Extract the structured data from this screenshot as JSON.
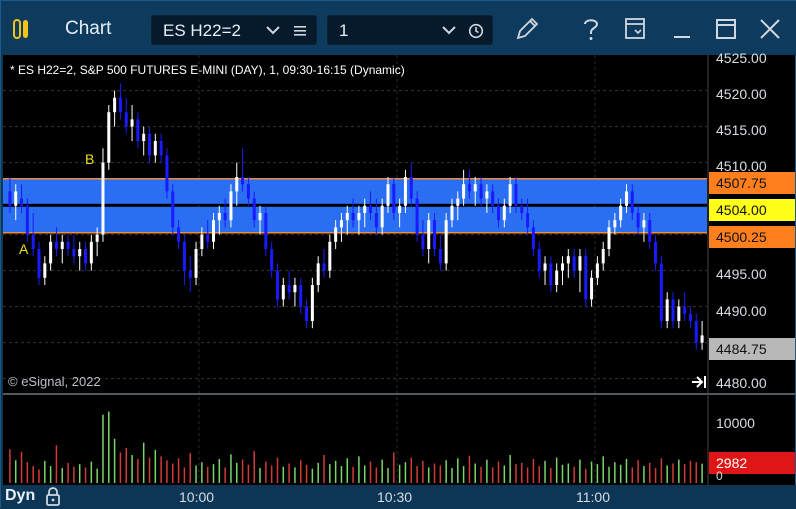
{
  "window": {
    "title": "Chart"
  },
  "toolbar": {
    "symbol": "ES H22=2",
    "interval": "1"
  },
  "chart": {
    "header": "* ES H22=2, S&P 500 FUTURES E-MINI (DAY), 1, 09:30-16:15 (Dynamic)",
    "copyright": "© eSignal, 2022",
    "price_ticks": [
      "4525.00",
      "4520.00",
      "4515.00",
      "4510.00",
      "4495.00",
      "4490.00",
      "4480.00"
    ],
    "price_tags": {
      "upper": "4507.75",
      "mid": "4504.00",
      "lower": "4500.25",
      "last": "4484.75"
    },
    "markers": {
      "a": "A",
      "b": "B"
    },
    "volume": {
      "tick": "10000",
      "tag": "2982",
      "zero": "0"
    },
    "time_ticks": [
      "10:00",
      "10:30",
      "11:00"
    ],
    "footer": {
      "mode": "Dyn"
    },
    "colors": {
      "up_candle": "#ffffff",
      "down_candle": "#1a1aff",
      "band": "#2a6ff2",
      "band_edge": "#f08c3c",
      "vol_up": "#7ad66a",
      "vol_down": "#d23a3a"
    }
  },
  "chart_data": {
    "type": "candlestick",
    "title": "* ES H22=2, S&P 500 FUTURES E-MINI (DAY), 1, 09:30-16:15 (Dynamic)",
    "x_axis": [
      "10:00",
      "10:30",
      "11:00"
    ],
    "ylim": [
      4478,
      4526
    ],
    "levels": {
      "band_upper": 4507.75,
      "band_mid": 4504.0,
      "band_lower": 4500.25,
      "last": 4484.75
    },
    "candles": [
      {
        "o": 4506,
        "h": 4508,
        "l": 4503,
        "c": 4504
      },
      {
        "o": 4504,
        "h": 4507,
        "l": 4502,
        "c": 4506
      },
      {
        "o": 4505,
        "h": 4507,
        "l": 4503,
        "c": 4504
      },
      {
        "o": 4504,
        "h": 4505,
        "l": 4499,
        "c": 4500
      },
      {
        "o": 4500,
        "h": 4503,
        "l": 4497,
        "c": 4498
      },
      {
        "o": 4498,
        "h": 4499,
        "l": 4493,
        "c": 4494
      },
      {
        "o": 4494,
        "h": 4497,
        "l": 4493,
        "c": 4496
      },
      {
        "o": 4496,
        "h": 4500,
        "l": 4495,
        "c": 4499
      },
      {
        "o": 4499,
        "h": 4501,
        "l": 4497,
        "c": 4498
      },
      {
        "o": 4498,
        "h": 4500,
        "l": 4496,
        "c": 4499
      },
      {
        "o": 4499,
        "h": 4500,
        "l": 4497,
        "c": 4498
      },
      {
        "o": 4498,
        "h": 4500,
        "l": 4496,
        "c": 4497
      },
      {
        "o": 4497,
        "h": 4499,
        "l": 4495,
        "c": 4498
      },
      {
        "o": 4498,
        "h": 4499,
        "l": 4495,
        "c": 4496
      },
      {
        "o": 4496,
        "h": 4500,
        "l": 4495,
        "c": 4499
      },
      {
        "o": 4499,
        "h": 4501,
        "l": 4497,
        "c": 4500
      },
      {
        "o": 4500,
        "h": 4512,
        "l": 4499,
        "c": 4510
      },
      {
        "o": 4510,
        "h": 4518,
        "l": 4509,
        "c": 4517
      },
      {
        "o": 4517,
        "h": 4520,
        "l": 4515,
        "c": 4519
      },
      {
        "o": 4519,
        "h": 4521,
        "l": 4516,
        "c": 4517
      },
      {
        "o": 4517,
        "h": 4519,
        "l": 4514,
        "c": 4515
      },
      {
        "o": 4515,
        "h": 4518,
        "l": 4513,
        "c": 4516
      },
      {
        "o": 4516,
        "h": 4517,
        "l": 4512,
        "c": 4513
      },
      {
        "o": 4513,
        "h": 4515,
        "l": 4511,
        "c": 4514
      },
      {
        "o": 4514,
        "h": 4515,
        "l": 4510,
        "c": 4511
      },
      {
        "o": 4511,
        "h": 4514,
        "l": 4510,
        "c": 4513
      },
      {
        "o": 4513,
        "h": 4514,
        "l": 4510,
        "c": 4511
      },
      {
        "o": 4511,
        "h": 4512,
        "l": 4505,
        "c": 4506
      },
      {
        "o": 4506,
        "h": 4507,
        "l": 4500,
        "c": 4501
      },
      {
        "o": 4501,
        "h": 4502,
        "l": 4498,
        "c": 4499
      },
      {
        "o": 4499,
        "h": 4500,
        "l": 4493,
        "c": 4495
      },
      {
        "o": 4495,
        "h": 4497,
        "l": 4492,
        "c": 4494
      },
      {
        "o": 4494,
        "h": 4499,
        "l": 4493,
        "c": 4498
      },
      {
        "o": 4498,
        "h": 4501,
        "l": 4497,
        "c": 4500
      },
      {
        "o": 4500,
        "h": 4502,
        "l": 4498,
        "c": 4499
      },
      {
        "o": 4499,
        "h": 4503,
        "l": 4498,
        "c": 4502
      },
      {
        "o": 4502,
        "h": 4504,
        "l": 4500,
        "c": 4503
      },
      {
        "o": 4503,
        "h": 4505,
        "l": 4501,
        "c": 4502
      },
      {
        "o": 4502,
        "h": 4507,
        "l": 4501,
        "c": 4506
      },
      {
        "o": 4506,
        "h": 4510,
        "l": 4504,
        "c": 4508
      },
      {
        "o": 4508,
        "h": 4512,
        "l": 4506,
        "c": 4507
      },
      {
        "o": 4507,
        "h": 4508,
        "l": 4504,
        "c": 4505
      },
      {
        "o": 4505,
        "h": 4506,
        "l": 4501,
        "c": 4502
      },
      {
        "o": 4502,
        "h": 4504,
        "l": 4500,
        "c": 4503
      },
      {
        "o": 4503,
        "h": 4504,
        "l": 4497,
        "c": 4498
      },
      {
        "o": 4498,
        "h": 4499,
        "l": 4494,
        "c": 4495
      },
      {
        "o": 4495,
        "h": 4496,
        "l": 4490,
        "c": 4491
      },
      {
        "o": 4491,
        "h": 4494,
        "l": 4490,
        "c": 4493
      },
      {
        "o": 4493,
        "h": 4495,
        "l": 4491,
        "c": 4492
      },
      {
        "o": 4492,
        "h": 4494,
        "l": 4490,
        "c": 4493
      },
      {
        "o": 4493,
        "h": 4494,
        "l": 4489,
        "c": 4490
      },
      {
        "o": 4490,
        "h": 4491,
        "l": 4487,
        "c": 4488
      },
      {
        "o": 4488,
        "h": 4494,
        "l": 4487,
        "c": 4493
      },
      {
        "o": 4493,
        "h": 4497,
        "l": 4492,
        "c": 4496
      },
      {
        "o": 4496,
        "h": 4498,
        "l": 4494,
        "c": 4495
      },
      {
        "o": 4495,
        "h": 4500,
        "l": 4494,
        "c": 4499
      },
      {
        "o": 4499,
        "h": 4502,
        "l": 4498,
        "c": 4501
      },
      {
        "o": 4501,
        "h": 4503,
        "l": 4499,
        "c": 4502
      },
      {
        "o": 4502,
        "h": 4504,
        "l": 4500,
        "c": 4503
      },
      {
        "o": 4503,
        "h": 4505,
        "l": 4501,
        "c": 4502
      },
      {
        "o": 4502,
        "h": 4504,
        "l": 4500,
        "c": 4503
      },
      {
        "o": 4503,
        "h": 4505,
        "l": 4501,
        "c": 4504
      },
      {
        "o": 4504,
        "h": 4506,
        "l": 4502,
        "c": 4503
      },
      {
        "o": 4503,
        "h": 4505,
        "l": 4500,
        "c": 4501
      },
      {
        "o": 4501,
        "h": 4505,
        "l": 4500,
        "c": 4504
      },
      {
        "o": 4504,
        "h": 4508,
        "l": 4503,
        "c": 4507
      },
      {
        "o": 4507,
        "h": 4508,
        "l": 4502,
        "c": 4503
      },
      {
        "o": 4503,
        "h": 4505,
        "l": 4501,
        "c": 4504
      },
      {
        "o": 4504,
        "h": 4509,
        "l": 4503,
        "c": 4508
      },
      {
        "o": 4508,
        "h": 4510,
        "l": 4504,
        "c": 4505
      },
      {
        "o": 4505,
        "h": 4506,
        "l": 4499,
        "c": 4500
      },
      {
        "o": 4500,
        "h": 4502,
        "l": 4497,
        "c": 4498
      },
      {
        "o": 4498,
        "h": 4503,
        "l": 4496,
        "c": 4502
      },
      {
        "o": 4502,
        "h": 4503,
        "l": 4497,
        "c": 4498
      },
      {
        "o": 4498,
        "h": 4500,
        "l": 4495,
        "c": 4496
      },
      {
        "o": 4496,
        "h": 4503,
        "l": 4495,
        "c": 4502
      },
      {
        "o": 4502,
        "h": 4505,
        "l": 4501,
        "c": 4504
      },
      {
        "o": 4504,
        "h": 4506,
        "l": 4502,
        "c": 4505
      },
      {
        "o": 4505,
        "h": 4509,
        "l": 4504,
        "c": 4507
      },
      {
        "o": 4507,
        "h": 4509,
        "l": 4505,
        "c": 4506
      },
      {
        "o": 4506,
        "h": 4508,
        "l": 4504,
        "c": 4507
      },
      {
        "o": 4507,
        "h": 4508,
        "l": 4504,
        "c": 4505
      },
      {
        "o": 4505,
        "h": 4507,
        "l": 4503,
        "c": 4506
      },
      {
        "o": 4506,
        "h": 4507,
        "l": 4503,
        "c": 4504
      },
      {
        "o": 4504,
        "h": 4505,
        "l": 4501,
        "c": 4502
      },
      {
        "o": 4502,
        "h": 4505,
        "l": 4501,
        "c": 4504
      },
      {
        "o": 4504,
        "h": 4508,
        "l": 4503,
        "c": 4507
      },
      {
        "o": 4507,
        "h": 4508,
        "l": 4503,
        "c": 4504
      },
      {
        "o": 4504,
        "h": 4505,
        "l": 4502,
        "c": 4503
      },
      {
        "o": 4503,
        "h": 4505,
        "l": 4500,
        "c": 4501
      },
      {
        "o": 4501,
        "h": 4502,
        "l": 4497,
        "c": 4498
      },
      {
        "o": 4498,
        "h": 4499,
        "l": 4494,
        "c": 4495
      },
      {
        "o": 4495,
        "h": 4497,
        "l": 4493,
        "c": 4496
      },
      {
        "o": 4496,
        "h": 4497,
        "l": 4492,
        "c": 4493
      },
      {
        "o": 4493,
        "h": 4496,
        "l": 4492,
        "c": 4495
      },
      {
        "o": 4495,
        "h": 4497,
        "l": 4493,
        "c": 4496
      },
      {
        "o": 4496,
        "h": 4498,
        "l": 4494,
        "c": 4497
      },
      {
        "o": 4497,
        "h": 4498,
        "l": 4494,
        "c": 4495
      },
      {
        "o": 4495,
        "h": 4498,
        "l": 4492,
        "c": 4497
      },
      {
        "o": 4497,
        "h": 4498,
        "l": 4490,
        "c": 4491
      },
      {
        "o": 4491,
        "h": 4495,
        "l": 4490,
        "c": 4494
      },
      {
        "o": 4494,
        "h": 4497,
        "l": 4493,
        "c": 4496
      },
      {
        "o": 4496,
        "h": 4499,
        "l": 4495,
        "c": 4498
      },
      {
        "o": 4498,
        "h": 4502,
        "l": 4497,
        "c": 4501
      },
      {
        "o": 4501,
        "h": 4503,
        "l": 4500,
        "c": 4502
      },
      {
        "o": 4502,
        "h": 4505,
        "l": 4501,
        "c": 4504
      },
      {
        "o": 4504,
        "h": 4507,
        "l": 4503,
        "c": 4506
      },
      {
        "o": 4506,
        "h": 4507,
        "l": 4502,
        "c": 4503
      },
      {
        "o": 4503,
        "h": 4504,
        "l": 4500,
        "c": 4501
      },
      {
        "o": 4501,
        "h": 4503,
        "l": 4499,
        "c": 4502
      },
      {
        "o": 4502,
        "h": 4503,
        "l": 4498,
        "c": 4499
      },
      {
        "o": 4499,
        "h": 4500,
        "l": 4495,
        "c": 4496
      },
      {
        "o": 4496,
        "h": 4497,
        "l": 4487,
        "c": 4488
      },
      {
        "o": 4488,
        "h": 4492,
        "l": 4487,
        "c": 4491
      },
      {
        "o": 4491,
        "h": 4492,
        "l": 4487,
        "c": 4488
      },
      {
        "o": 4488,
        "h": 4491,
        "l": 4487,
        "c": 4490
      },
      {
        "o": 4490,
        "h": 4492,
        "l": 4488,
        "c": 4489
      },
      {
        "o": 4489,
        "h": 4490,
        "l": 4487,
        "c": 4488
      },
      {
        "o": 4488,
        "h": 4489,
        "l": 4484,
        "c": 4485
      },
      {
        "o": 4485,
        "h": 4488,
        "l": 4484,
        "c": 4486
      }
    ],
    "volume_ylim": [
      0,
      12000
    ],
    "volume": [
      5200,
      3500,
      4800,
      3200,
      2600,
      2100,
      3400,
      2600,
      5800,
      2300,
      3100,
      2500,
      2900,
      2400,
      3300,
      2200,
      10500,
      11000,
      6800,
      4700,
      5400,
      4300,
      3700,
      6200,
      3900,
      5100,
      4100,
      3500,
      3000,
      3800,
      2400,
      4600,
      2700,
      3200,
      2500,
      2900,
      3700,
      2400,
      4400,
      3100,
      3600,
      2800,
      4900,
      2300,
      3300,
      2700,
      3900,
      2500,
      3000,
      2400,
      3500,
      2800,
      2200,
      3100,
      4300,
      2900,
      3400,
      2600,
      3800,
      2500,
      4100,
      2700,
      3300,
      2400,
      3600,
      2300,
      4700,
      2800,
      3200,
      3900,
      2600,
      3400,
      2400,
      3000,
      2700,
      3500,
      2300,
      3800,
      2600,
      4200,
      3000,
      2500,
      3600,
      2400,
      3300,
      2700,
      4300,
      2900,
      3100,
      2400,
      3700,
      2600,
      3400,
      2300,
      3900,
      2800,
      3000,
      2500,
      3600,
      2200,
      3300,
      2900,
      4100,
      2500,
      3200,
      2800,
      3700,
      2400,
      3500,
      2600,
      3100,
      2300,
      3800,
      2700,
      3000,
      3600,
      2900,
      3400,
      3200,
      2982
    ]
  }
}
